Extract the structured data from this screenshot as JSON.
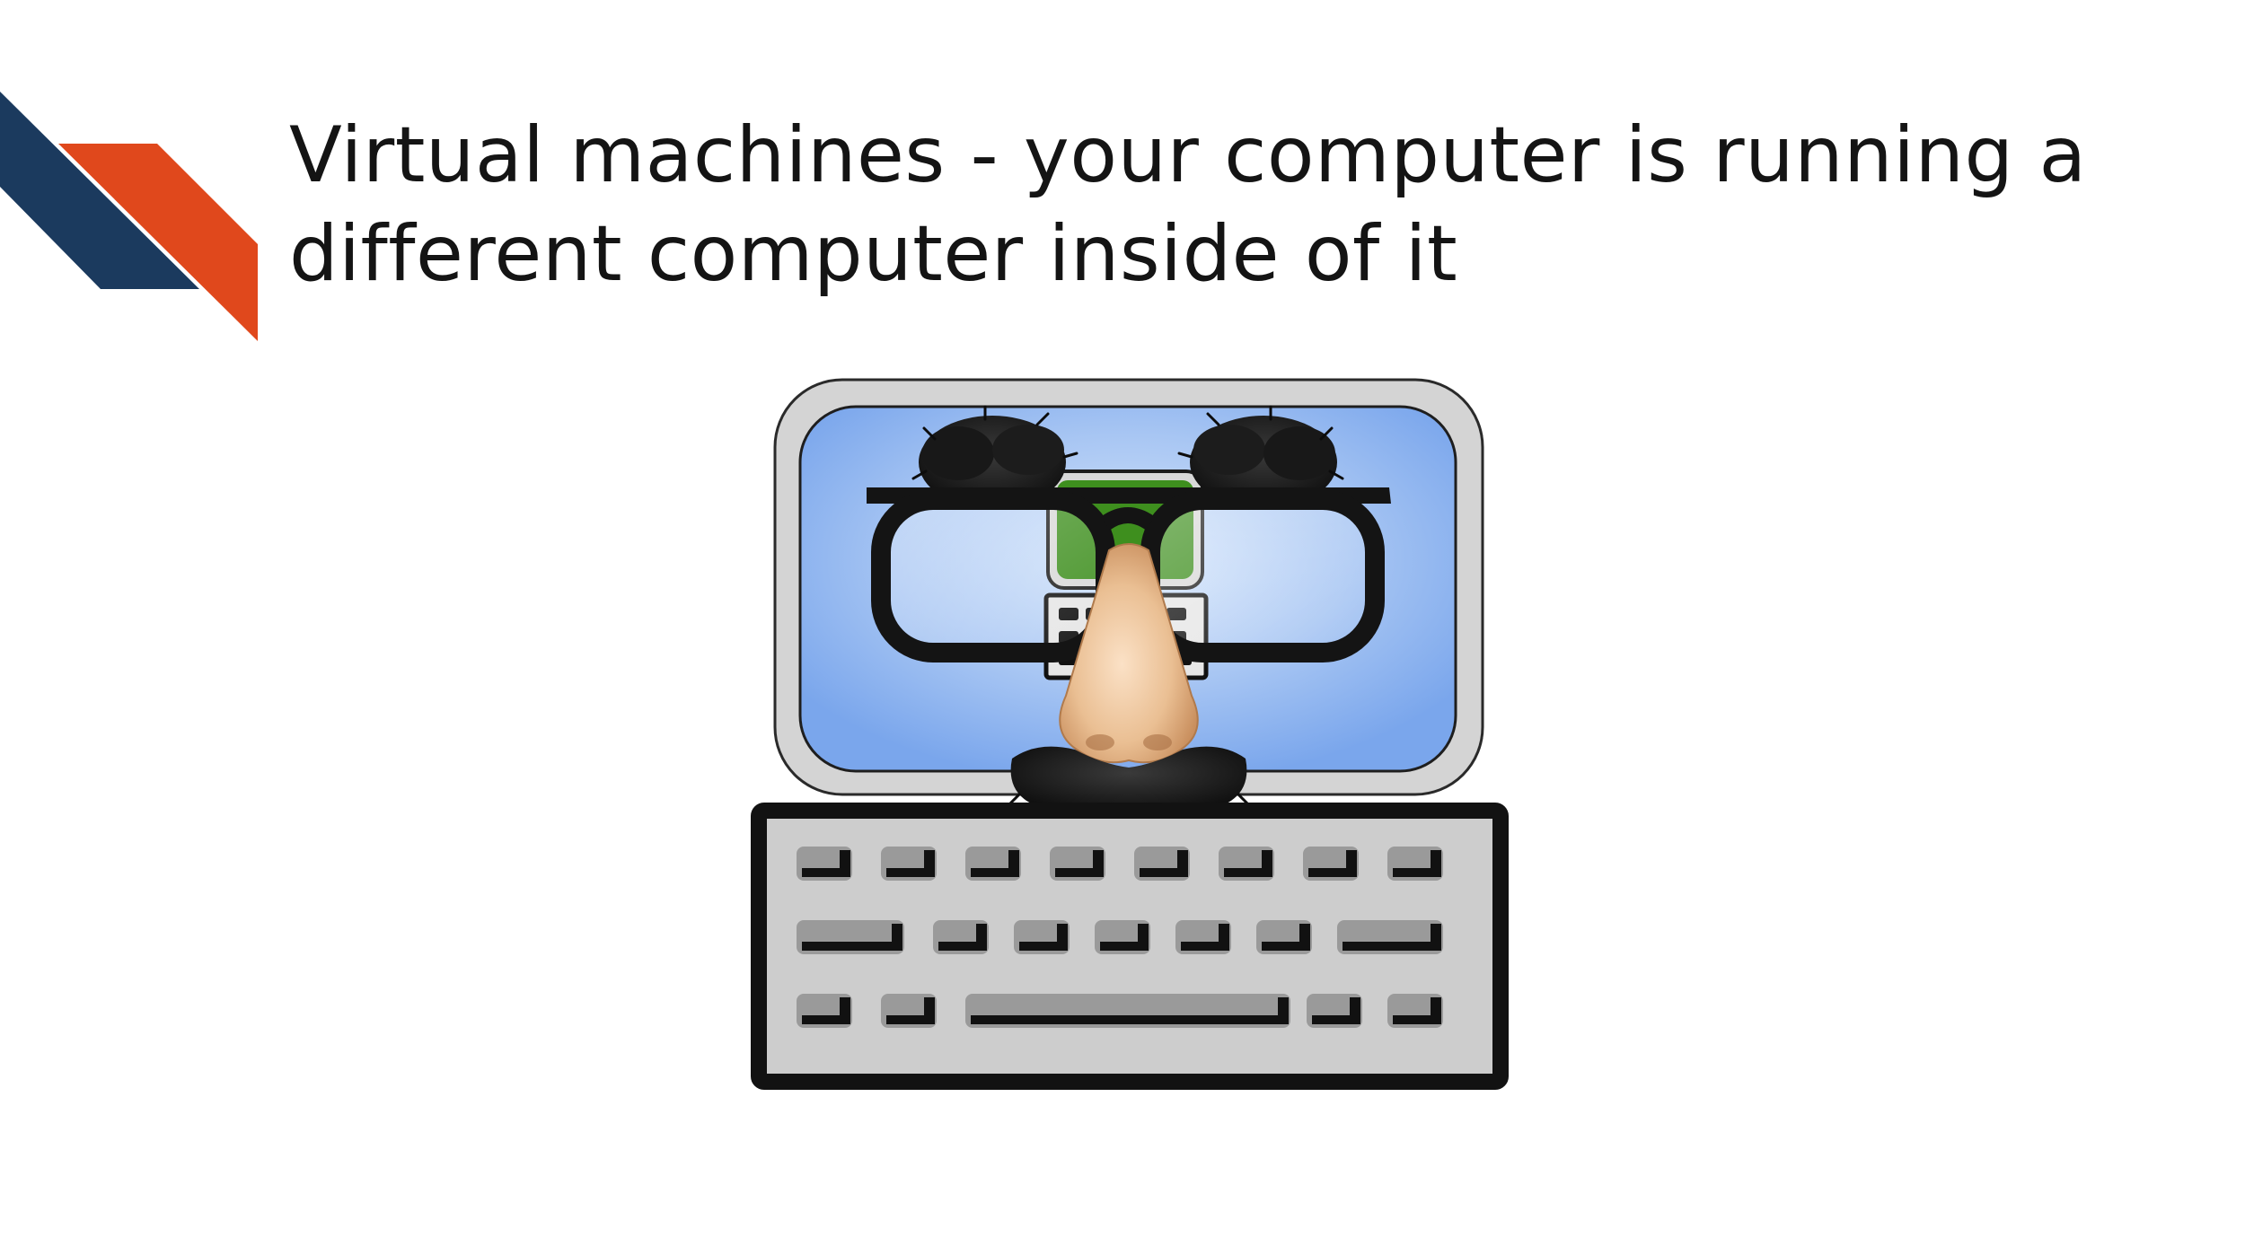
{
  "slide": {
    "title": "Virtual machines - your computer is running a different computer inside of it",
    "illustration_icon": "disguised-computer-icon"
  },
  "colors": {
    "navy_stripe": "#1b3a5e",
    "orange_stripe": "#e0481c",
    "screen_blue": "#7aa6ec",
    "inner_screen_green": "#3e8f1e",
    "keyboard_gray": "#cfcfcf",
    "nose_tan": "#e6b487",
    "fur_black": "#161616"
  }
}
